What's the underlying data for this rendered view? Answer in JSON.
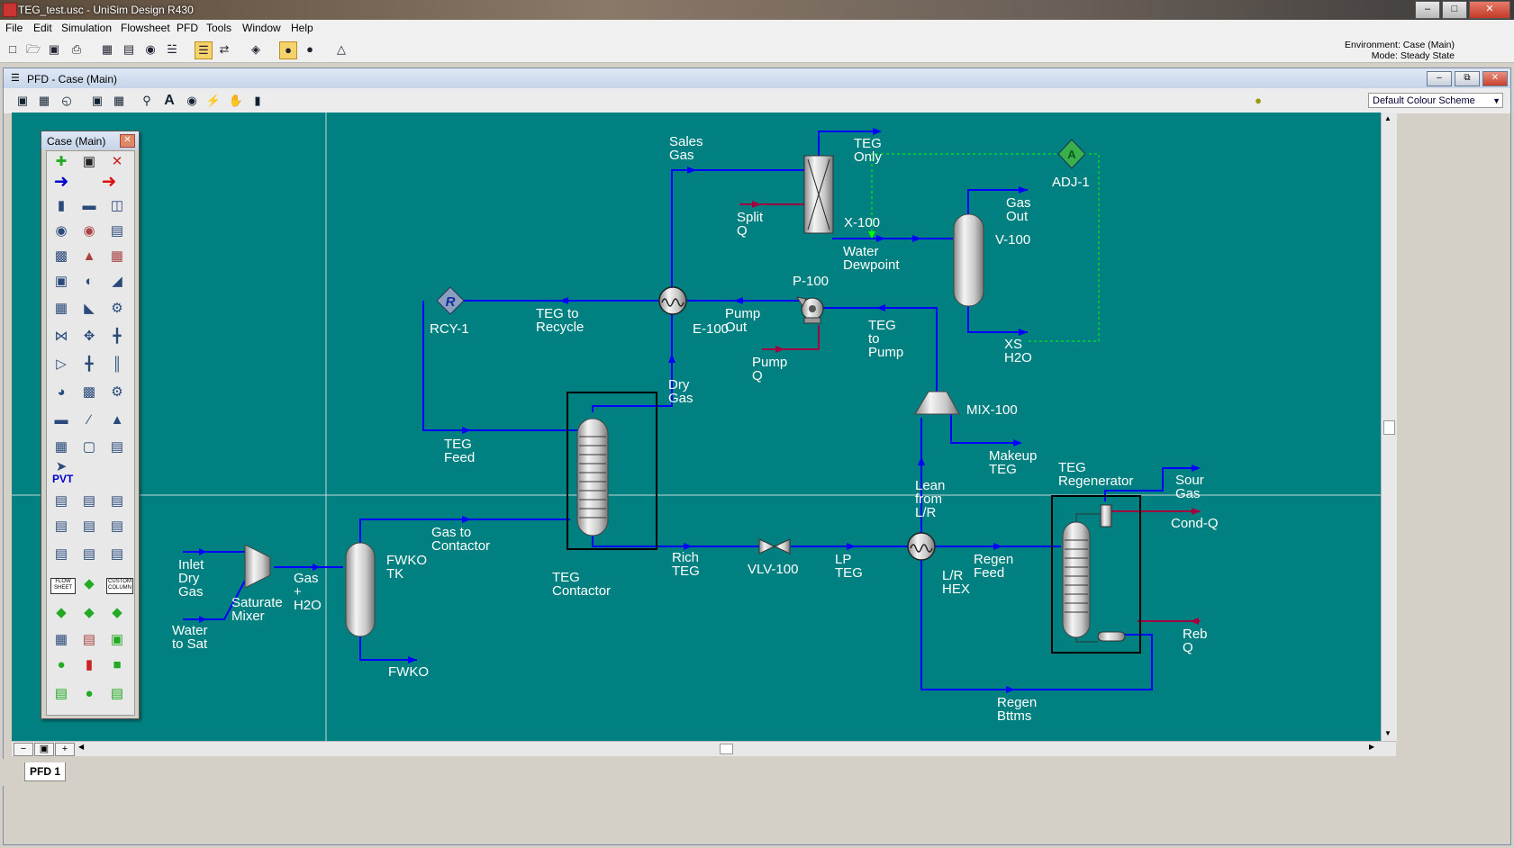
{
  "window": {
    "title": "TEG_test.usc - UniSim Design R430",
    "min": "–",
    "max": "□",
    "close": "✕"
  },
  "menu": [
    "File",
    "Edit",
    "Simulation",
    "Flowsheet",
    "PFD",
    "Tools",
    "Window",
    "Help"
  ],
  "environment": {
    "line1": "Environment: Case (Main)",
    "line2": "Mode: Steady State"
  },
  "child": {
    "title": "PFD - Case (Main)",
    "min": "–",
    "restore": "⧉",
    "close": "✕"
  },
  "scheme": {
    "selected": "Default Colour Scheme"
  },
  "palette": {
    "title": "Case (Main)",
    "pvt": "PVT",
    "flowsheet": "FLOW SHEET",
    "custom": "CUSTOM COLUMN"
  },
  "tab": {
    "label": "PFD 1"
  },
  "labels": {
    "sales_gas": "Sales\nGas",
    "teg_only": "TEG\nOnly",
    "adj": "ADJ-1",
    "gas_out": "Gas\nOut",
    "split_q": "Split\nQ",
    "x100": "X-100",
    "water_dewpoint": "Water\nDewpoint",
    "v100": "V-100",
    "p100": "P-100",
    "rcy": "RCY-1",
    "teg_recycle": "TEG to\nRecycle",
    "e100": "E-100",
    "pump_out": "Pump\nOut",
    "teg_to_pump": "TEG\nto\nPump",
    "xs_h2o": "XS\nH2O",
    "pump_q": "Pump\nQ",
    "dry_gas": "Dry\nGas",
    "mix100": "MIX-100",
    "teg_feed": "TEG\nFeed",
    "makeup_teg": "Makeup\nTEG",
    "teg_regenerator": "TEG\nRegenerator",
    "sour_gas": "Sour\nGas",
    "lean_lr": "Lean\nfrom\nL/R",
    "cond_q": "Cond-Q",
    "gas_to_contactor": "Gas to\nContactor",
    "fwko_tk": "FWKO\nTK",
    "inlet_dry_gas": "Inlet\nDry\nGas",
    "gas_h2o": "Gas\n+\nH2O",
    "saturate_mixer": "Saturate\nMixer",
    "teg_contactor": "TEG\nContactor",
    "rich_teg": "Rich\nTEG",
    "vlv100": "VLV-100",
    "lp_teg": "LP\nTEG",
    "lr_hex": "L/R\nHEX",
    "regen_feed": "Regen\nFeed",
    "reb_q": "Reb\nQ",
    "water_to_sat": "Water\nto Sat",
    "fwko": "FWKO",
    "regen_bttms": "Regen\nBttms"
  },
  "colors": {
    "canvas": "#008080",
    "material": "#0000ff",
    "energy": "#a00040",
    "logic": "#00ff00"
  }
}
